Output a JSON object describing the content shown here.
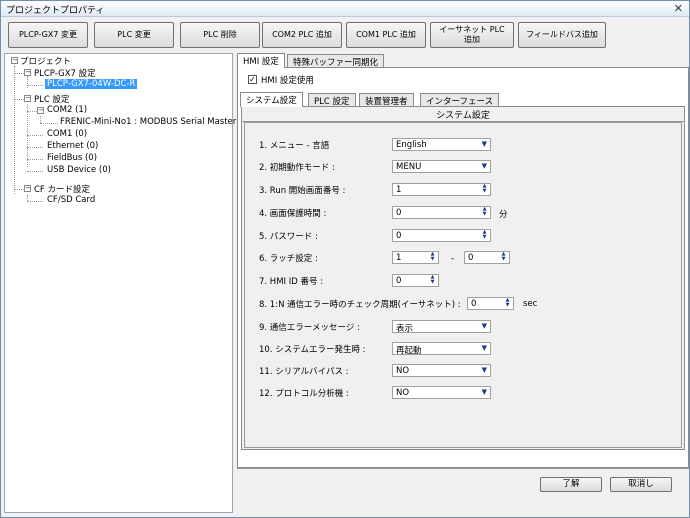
{
  "window": {
    "title": "プロジェクトプロパティ",
    "close_glyph": "✕"
  },
  "toolbar": {
    "buttons": [
      {
        "label": "PLCP-GX7 変更"
      },
      {
        "label": "PLC 変更"
      },
      {
        "label": "PLC 削除"
      },
      {
        "label": "COM2 PLC 追加"
      },
      {
        "label": "COM1 PLC 追加"
      },
      {
        "label": "イーサネット PLC\n追加"
      },
      {
        "label": "フィールドバス追加"
      }
    ]
  },
  "tree": {
    "root": "プロジェクト",
    "gx7": "PLCP-GX7 設定",
    "gx7_model": "PLCP-GX7-04W-DC-R",
    "plc": "PLC 設定",
    "com2": "COM2 (1)",
    "com2_child": "FRENIC-Mini-No1 : MODBUS Serial Master",
    "com1": "COM1 (0)",
    "ethernet": "Ethernet (0)",
    "fieldbus": "FieldBus (0)",
    "usb": "USB Device (0)",
    "cf": "CF カード設定",
    "cfsd": "CF/SD Card"
  },
  "tabs_top": [
    {
      "label": "HMI 設定",
      "active": true
    },
    {
      "label": "特殊バッファー同期化",
      "active": false
    }
  ],
  "hmi_checkbox": {
    "label": "HMI 設定使用",
    "checked": true,
    "mark": "✓"
  },
  "tabs_sub": [
    {
      "label": "システム設定",
      "active": true
    },
    {
      "label": "PLC 設定",
      "active": false
    },
    {
      "label": "装置管理者",
      "active": false
    },
    {
      "label": "インターフェース",
      "active": false
    }
  ],
  "system": {
    "section_title": "システム設定",
    "rows": [
      {
        "label": "1. メニュー - 言語",
        "value": "English",
        "kind": "dropdown"
      },
      {
        "label": "2. 初期動作モード :",
        "value": "MENU",
        "kind": "dropdown"
      },
      {
        "label": "3. Run 開始画面番号 :",
        "value": "1",
        "kind": "spin"
      },
      {
        "label": "4. 画面保護時間 :",
        "value": "0",
        "kind": "spin",
        "unit": "分"
      },
      {
        "label": "5. パスワード :",
        "value": "0",
        "kind": "spin"
      },
      {
        "label": "6. ラッチ設定 :",
        "value": "1",
        "value2": "0",
        "separator": "-",
        "kind": "range"
      },
      {
        "label": "7. HMI ID 番号 :",
        "value": "0",
        "kind": "spin"
      },
      {
        "label": "8. 1:N 通信エラー時のチェック周期(イーサネット) :",
        "value": "0",
        "kind": "spin",
        "unit": "sec"
      },
      {
        "label": "9. 通信エラーメッセージ :",
        "value": "表示",
        "kind": "dropdown"
      },
      {
        "label": "10. システムエラー発生時 :",
        "value": "再起動",
        "kind": "dropdown"
      },
      {
        "label": "11. シリアルバイパス :",
        "value": "NO",
        "kind": "dropdown"
      },
      {
        "label": "12. プロトコル分析機 :",
        "value": "NO",
        "kind": "dropdown"
      }
    ]
  },
  "buttons": {
    "ok": "了解",
    "cancel": "取消し"
  },
  "icons": {
    "dropdown": "▼",
    "spin_up": "▲",
    "spin_down": "▼",
    "expand": "−"
  }
}
